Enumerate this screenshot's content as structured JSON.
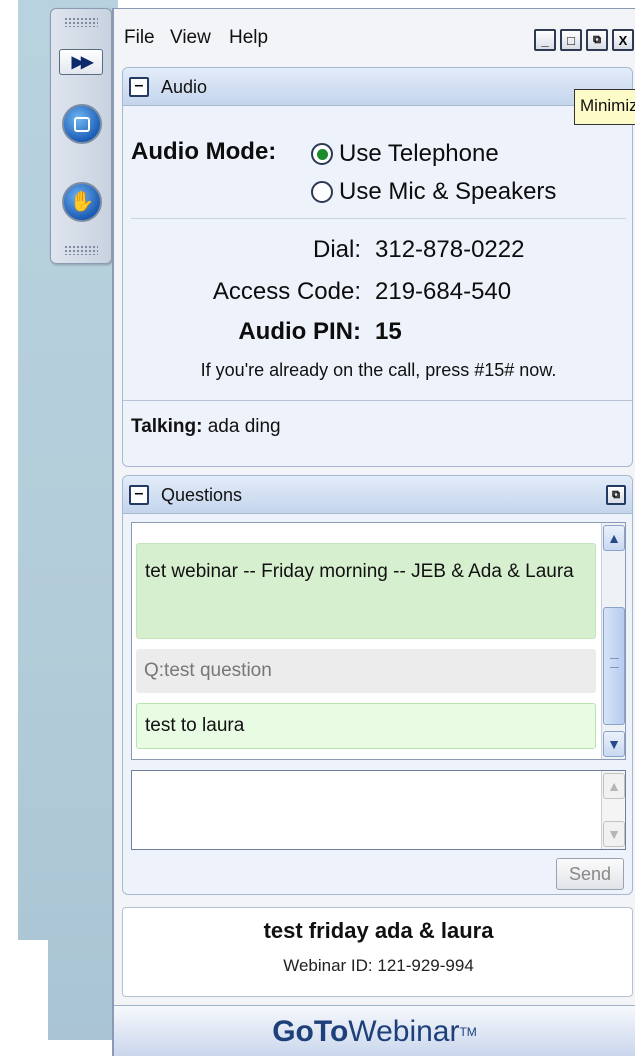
{
  "menubar": {
    "file": "File",
    "view": "View",
    "help": "Help"
  },
  "window_buttons": {
    "minimize": "_",
    "maximize": "□",
    "restore": "⧉",
    "close": "X"
  },
  "tooltip": "Minimize",
  "grab_tab": {
    "expand_glyph": "▶▶",
    "icons": [
      "screen-share-icon",
      "raise-hand-icon"
    ]
  },
  "audio": {
    "header": "Audio",
    "mode_label": "Audio Mode:",
    "options": [
      {
        "label": "Use Telephone",
        "selected": true
      },
      {
        "label": "Use Mic & Speakers",
        "selected": false
      }
    ],
    "dial_label": "Dial:",
    "dial_value": "312-878-0222",
    "access_label": "Access Code:",
    "access_value": "219-684-540",
    "pin_label": "Audio PIN:",
    "pin_value": "15",
    "note": "If you're already on the call, press #15# now.",
    "talking_label": "Talking:",
    "talking_value": "ada ding"
  },
  "questions": {
    "header": "Questions",
    "items": [
      {
        "text": "tet webinar -- Friday morning -- JEB & Ada & Laura"
      },
      {
        "text": "Q:test question"
      },
      {
        "text": "test to laura"
      }
    ],
    "input_value": "",
    "send_label": "Send"
  },
  "webinar": {
    "title": "test friday ada & laura",
    "id_text": "Webinar ID: 121-929-994"
  },
  "brand": {
    "goto": "GoTo",
    "webinar": "Webinar",
    "tm": "TM"
  },
  "colors": {
    "accent": "#1d3f7a",
    "question_highlight": "#d6f0cf",
    "tooltip_bg": "#fdfbc7"
  }
}
